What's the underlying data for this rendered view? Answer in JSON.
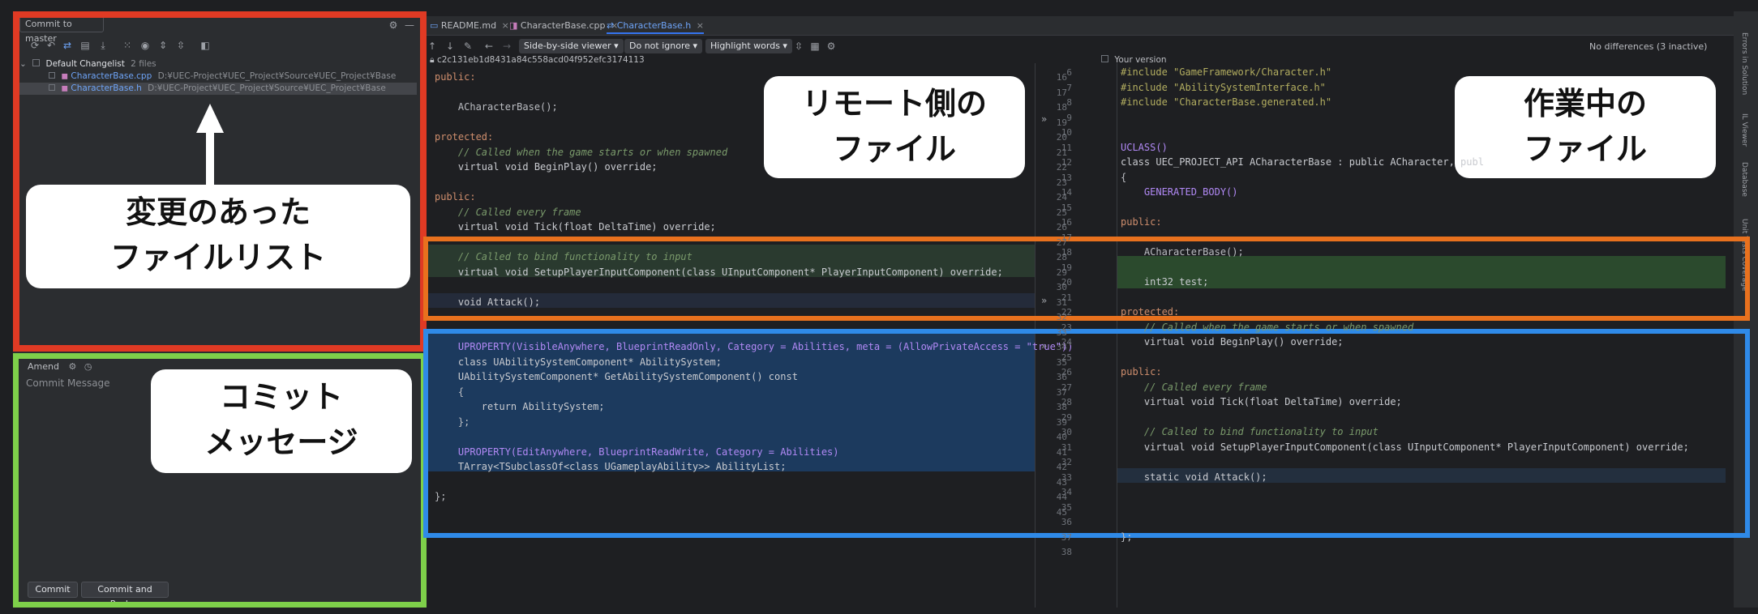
{
  "commit_panel": {
    "title": "Commit to master",
    "changelist": {
      "name": "Default Changelist",
      "count": "2 files"
    },
    "files": [
      {
        "name": "CharacterBase.cpp",
        "path": "D:¥UEC-Project¥UEC_Project¥Source¥UEC_Project¥Base"
      },
      {
        "name": "CharacterBase.h",
        "path": "D:¥UEC-Project¥UEC_Project¥Source¥UEC_Project¥Base"
      }
    ],
    "amend_label": "Amend",
    "message_placeholder": "Commit Message",
    "commit_button": "Commit",
    "commit_push_button": "Commit and Push..."
  },
  "tabs": [
    {
      "label": "README.md"
    },
    {
      "label": "CharacterBase.cpp"
    },
    {
      "label": "CharacterBase.h"
    }
  ],
  "diff_toolbar": {
    "viewer": "Side-by-side viewer ▾",
    "ignore": "Do not ignore ▾",
    "highlight": "Highlight words ▾",
    "status": "No differences (3 inactive)",
    "left_hash": "c2c131eb1d8431a84c558acd04f952efc3174113",
    "right_label": "Your version"
  },
  "left_code": [
    {
      "ln": "16",
      "text": "public:"
    },
    {
      "ln": "17",
      "text": ""
    },
    {
      "ln": "18",
      "text": "    ACharacterBase();"
    },
    {
      "ln": "19",
      "text": ""
    },
    {
      "ln": "20",
      "text": "protected:"
    },
    {
      "ln": "21",
      "text": "    // Called when the game starts or when spawned"
    },
    {
      "ln": "22",
      "text": "    virtual void BeginPlay() override;"
    },
    {
      "ln": "23",
      "text": ""
    },
    {
      "ln": "24",
      "text": "public:"
    },
    {
      "ln": "25",
      "text": "    // Called every frame"
    },
    {
      "ln": "26",
      "text": "    virtual void Tick(float DeltaTime) override;"
    },
    {
      "ln": "27",
      "text": ""
    },
    {
      "ln": "28",
      "text": "    // Called to bind functionality to input"
    },
    {
      "ln": "29",
      "text": "    virtual void SetupPlayerInputComponent(class UInputComponent* PlayerInputComponent) override;"
    },
    {
      "ln": "30",
      "text": ""
    },
    {
      "ln": "31",
      "text": "    void Attack();"
    },
    {
      "ln": "32",
      "text": ""
    },
    {
      "ln": "33",
      "text": ""
    },
    {
      "ln": "34",
      "text": "    UPROPERTY(VisibleAnywhere, BlueprintReadOnly, Category = Abilities, meta = (AllowPrivateAccess = \"true\"))"
    },
    {
      "ln": "35",
      "text": "    class UAbilitySystemComponent* AbilitySystem;"
    },
    {
      "ln": "36",
      "text": "    UAbilitySystemComponent* GetAbilitySystemComponent() const"
    },
    {
      "ln": "37",
      "text": "    {"
    },
    {
      "ln": "38",
      "text": "        return AbilitySystem;"
    },
    {
      "ln": "39",
      "text": "    };"
    },
    {
      "ln": "40",
      "text": ""
    },
    {
      "ln": "41",
      "text": "    UPROPERTY(EditAnywhere, BlueprintReadWrite, Category = Abilities)"
    },
    {
      "ln": "42",
      "text": "    TArray<TSubclassOf<class UGameplayAbility>> AbilityList;"
    },
    {
      "ln": "43",
      "text": ""
    },
    {
      "ln": "44",
      "text": "};"
    },
    {
      "ln": "45",
      "text": ""
    }
  ],
  "right_code": [
    {
      "ln": "6",
      "text": "#include \"GameFramework/Character.h\""
    },
    {
      "ln": "7",
      "text": "#include \"AbilitySystemInterface.h\""
    },
    {
      "ln": "8",
      "text": "#include \"CharacterBase.generated.h\""
    },
    {
      "ln": "9",
      "text": ""
    },
    {
      "ln": "10",
      "text": ""
    },
    {
      "ln": "11",
      "text": "UCLASS()"
    },
    {
      "ln": "12",
      "text": "class UEC_PROJECT_API ACharacterBase : public ACharacter, publ"
    },
    {
      "ln": "13",
      "text": "{"
    },
    {
      "ln": "14",
      "text": "    GENERATED_BODY()"
    },
    {
      "ln": "15",
      "text": ""
    },
    {
      "ln": "16",
      "text": "public:"
    },
    {
      "ln": "17",
      "text": ""
    },
    {
      "ln": "18",
      "text": "    ACharacterBase();"
    },
    {
      "ln": "19",
      "text": ""
    },
    {
      "ln": "20",
      "text": "    int32 test;"
    },
    {
      "ln": "21",
      "text": ""
    },
    {
      "ln": "22",
      "text": "protected:"
    },
    {
      "ln": "23",
      "text": "    // Called when the game starts or when spawned"
    },
    {
      "ln": "24",
      "text": "    virtual void BeginPlay() override;"
    },
    {
      "ln": "25",
      "text": ""
    },
    {
      "ln": "26",
      "text": "public:"
    },
    {
      "ln": "27",
      "text": "    // Called every frame"
    },
    {
      "ln": "28",
      "text": "    virtual void Tick(float DeltaTime) override;"
    },
    {
      "ln": "29",
      "text": ""
    },
    {
      "ln": "30",
      "text": "    // Called to bind functionality to input"
    },
    {
      "ln": "31",
      "text": "    virtual void SetupPlayerInputComponent(class UInputComponent* PlayerInputComponent) override;"
    },
    {
      "ln": "32",
      "text": ""
    },
    {
      "ln": "33",
      "text": "    static void Attack();"
    },
    {
      "ln": "34",
      "text": ""
    },
    {
      "ln": "35",
      "text": ""
    },
    {
      "ln": "36",
      "text": ""
    },
    {
      "ln": "37",
      "text": "};"
    },
    {
      "ln": "38",
      "text": ""
    }
  ],
  "callouts": {
    "file_list": [
      "変更のあった",
      "ファイルリスト"
    ],
    "commit_message": [
      "コミット",
      "メッセージ"
    ],
    "remote": [
      "リモート側の",
      "ファイル"
    ],
    "working": [
      "作業中の",
      "ファイル"
    ]
  },
  "side_strip": [
    "Errors in Solution",
    "IL Viewer",
    "Database",
    "Unit Tests Coverage"
  ],
  "colors": {
    "red_frame": "#e03a24",
    "green_frame": "#7ed04a",
    "orange_frame": "#e8711e",
    "blue_frame": "#2f8ae8"
  }
}
